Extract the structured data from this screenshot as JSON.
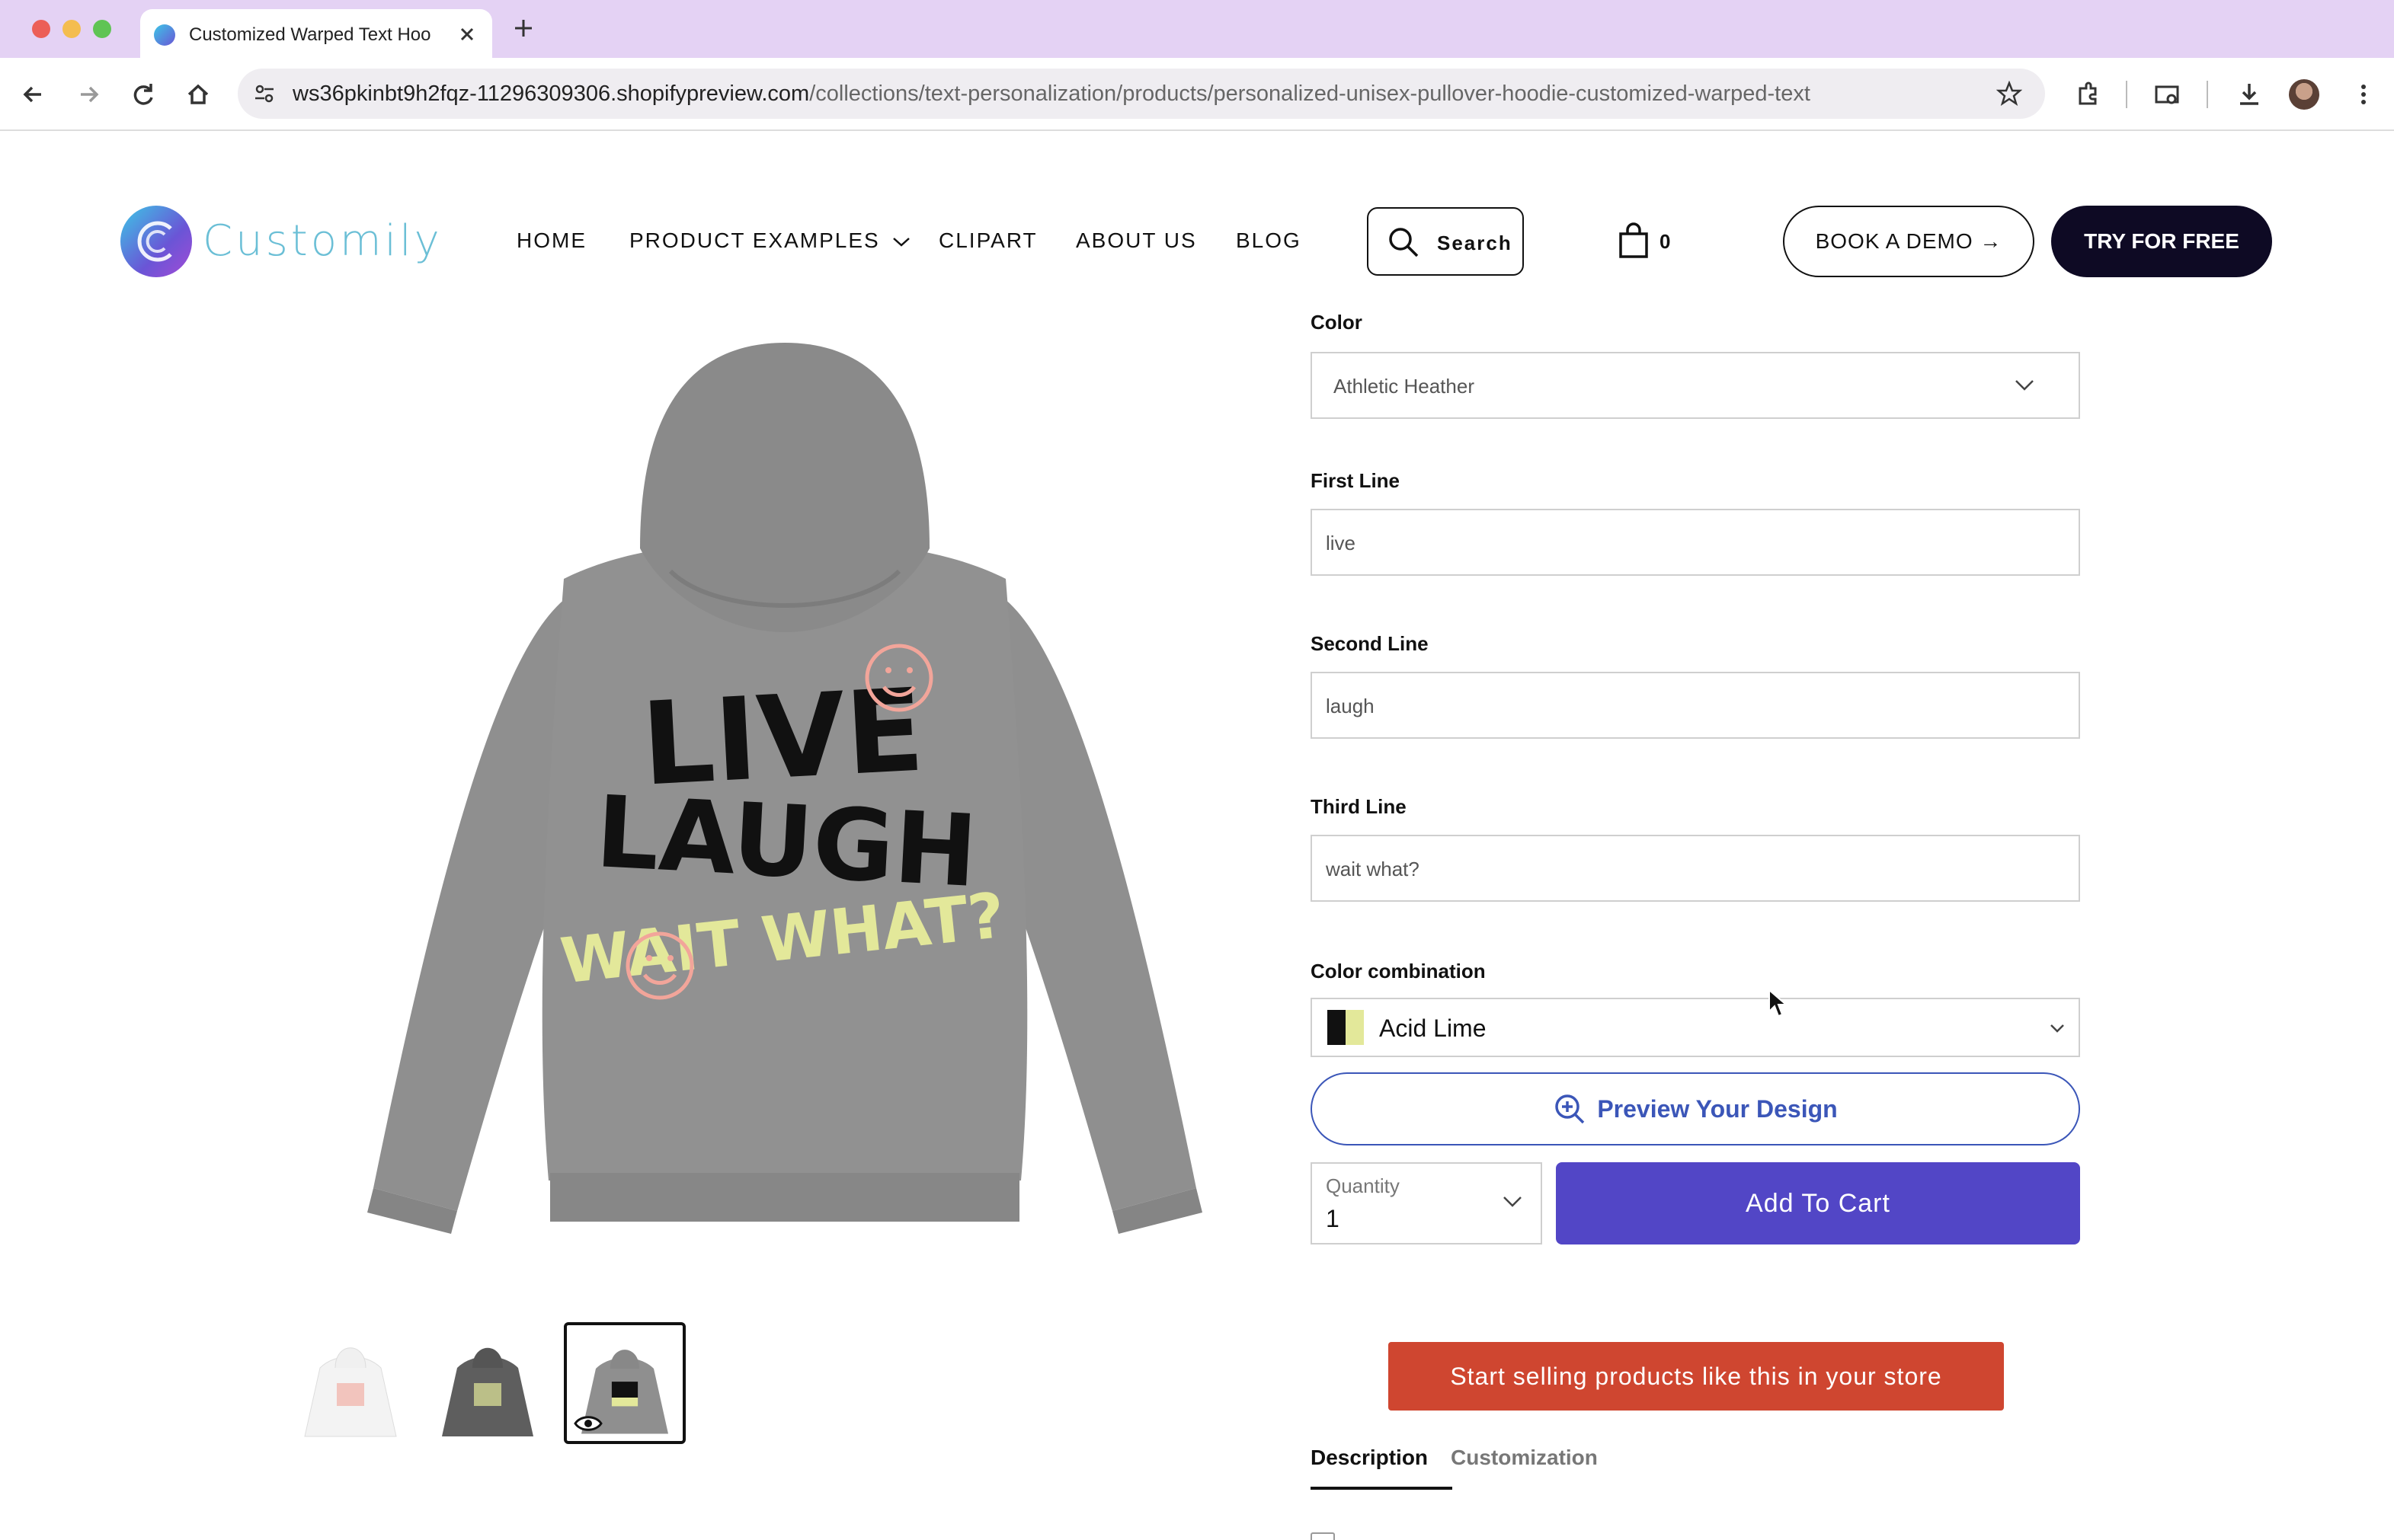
{
  "browser": {
    "tab_title": "Customized Warped Text Hoo",
    "url_domain": "ws36pkinbt9h2fqz-11296309306.shopifypreview.com",
    "url_path": "/collections/text-personalization/products/personalized-unisex-pullover-hoodie-customized-warped-text"
  },
  "header": {
    "logo_text": "Customily",
    "nav": [
      "HOME",
      "PRODUCT EXAMPLES",
      "CLIPART",
      "ABOUT US",
      "BLOG"
    ],
    "search_label": "Search",
    "cart_count": "0",
    "book_demo": "BOOK A DEMO →",
    "try_free": "TRY FOR FREE"
  },
  "product": {
    "print_lines": [
      "LIVE",
      "LAUGH",
      "WAIT WHAT?"
    ],
    "colors": {
      "hoodie": "#8f8f8f",
      "primary_text": "#111111",
      "secondary_text": "#e3e89a",
      "smiley": "#f2a59a"
    }
  },
  "form": {
    "color_label": "Color",
    "color_value": "Athletic Heather",
    "first_line_label": "First Line",
    "first_line_value": "live",
    "second_line_label": "Second Line",
    "second_line_value": "laugh",
    "third_line_label": "Third Line",
    "third_line_value": "wait what?",
    "combo_label": "Color combination",
    "combo_value": "Acid Lime",
    "combo_swatch": [
      "#111111",
      "#e3e89a"
    ],
    "preview_label": "Preview Your Design",
    "quantity_label": "Quantity",
    "quantity_value": "1",
    "add_to_cart": "Add To Cart",
    "sell_cta": "Start selling products like this in your store"
  },
  "tabs": {
    "description": "Description",
    "customization": "Customization"
  },
  "theme": {
    "accent": "#5246c6",
    "cta_red": "#cf4630",
    "dark": "#0e0a24",
    "link_blue": "#3b56b8"
  }
}
